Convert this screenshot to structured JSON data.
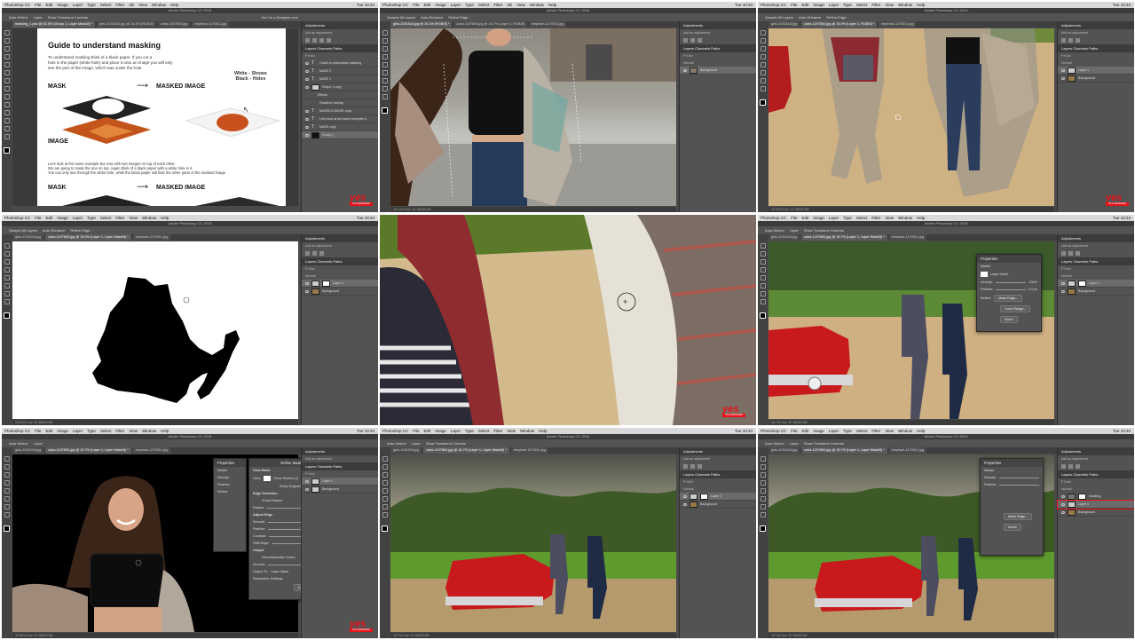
{
  "app": {
    "menu": [
      "Photoshop CC",
      "File",
      "Edit",
      "Image",
      "Layer",
      "Type",
      "Select",
      "Filter",
      "3D",
      "View",
      "Window",
      "Help"
    ],
    "window_title": "Adobe Photoshop CC 2016",
    "workspace_hint": "Yes I'm a Designer.com",
    "clock": "Tue 10:34"
  },
  "options": {
    "auto_select": "Auto-Select:",
    "layer": "Layer",
    "show_transform": "Show Transform Controls",
    "sample_all": "Sample All Layers",
    "auto_enhance": "Auto-Enhance",
    "refine_edge": "Refine Edge..."
  },
  "panels": {
    "adjustments": "Adjustments",
    "add_adjustment": "Add an adjustment",
    "layers_tabs": "Layers  Channels  Paths",
    "kind": "P Kind",
    "normal": "Normal",
    "opacity": "Opacity: 100%",
    "lock": "Lock:",
    "fill": "Fill: 100%",
    "properties": "Properties",
    "masks": "Masks",
    "layer_mask": "Layer Mask",
    "density": "Density:",
    "feather": "Feather:",
    "refine": "Refine:",
    "mask_edge": "Mask Edge...",
    "color_range": "Color Range...",
    "invert": "Invert",
    "density_value": "100%",
    "feather_value": "0.0 px"
  },
  "layers": {
    "background": "Background",
    "layer1": "Layer 1",
    "doc_layers": [
      "Guide to understand masking",
      "MASK 2",
      "MASK 1",
      "Shape 1 copy",
      "Effects",
      "Gradient Overlay",
      "MASKED IMAGE copy",
      "Let's look at the same example b...",
      "MASK copy",
      "Group 1"
    ],
    "masking_layer": "masking"
  },
  "tabs": [
    [
      "masking_1.psd @ 62.5% (Group 1, Layer Mask/8) *",
      "girls-1031518.jpg @ 16.1% (RGB/8)",
      "cuba-1197800.jpg",
      "elephant-1170511.jpg",
      "sea-918999.psd"
    ],
    [
      "girls-1031518.jpg @ 16.1% (RGB/8) *",
      "cuba-1197800.jpg @ 15.7% (Layer 1, RGB/8)",
      "elephant-1170511.jpg",
      "sea-918999.psd"
    ],
    [
      "girls-1031518.jpg",
      "cuba-1197800.jpg @ 15.0% (Layer 1, RGB/8) *",
      "elephant-1170511.jpg",
      "sea-918999.psd"
    ],
    [
      "girls-1031518.jpg",
      "cuba-1197800.jpg @ 15.0% (Layer 1, Layer Mask/8) *",
      "elephant-1170511.jpg",
      "sea-918999.psd"
    ],
    [
      "girls-1031518.jpg",
      "cuba-1197800.jpg @ 15.7% (Layer 1, Layer Mask/8) *",
      "elephant-1170511.jpg",
      "sea-918999.psd"
    ],
    [
      "girls-1031518.jpg",
      "cuba-1197800.jpg @ 15.7% (Layer 1, Layer Mask/8) *",
      "elephant-1170511.jpg",
      "sea-918999.psd"
    ],
    [
      "girls-1031518.jpg",
      "cuba-1197800.jpg @ 16.7% (Layer 1, Layer Mask/8) *",
      "elephant-1170511.jpg",
      "sea-918999.psd"
    ],
    [
      "girls-1031518.jpg",
      "cuba-1197800.jpg @ 15.7% (Layer 1, Layer Mask/8) *",
      "elephant-1170511.jpg",
      "sea-918999.psd"
    ]
  ],
  "status": [
    "62.5%   Doc: 3.29M/37.1M",
    "16.13%   Doc: 40.3M/28.4M",
    "15.02%   Doc: 57.9M/25.9M",
    "15.02%   Doc: 57.9M/25.9M",
    "15.7%   Doc: 57.9M/25.9M",
    "16.66%   Doc: 57.9M/25.9M",
    "15.7%   Doc: 57.9M/25.9M"
  ],
  "guide": {
    "title": "Guide to understand masking",
    "intro": [
      "To understand masking think of a black paper. If you cut a",
      "hole in the paper (white hole) and place it onto an image you will only",
      "see the part of the image, which was under the hole."
    ],
    "mask": "MASK",
    "masked_image": "MASKED IMAGE",
    "image": "IMAGE",
    "legend": [
      "White - Shows",
      "Black - Hides"
    ],
    "second": [
      "Let's look at the same example but now with two images on top of each other.",
      "We are going to mask the one on top. Again think of a black paper with a white hole in it.",
      "You can only see through the white hole, while the black paper will hide the other parts of the masked image"
    ],
    "mask2": "MASK",
    "masked_image2": "MASKED IMAGE"
  },
  "refine_mask": {
    "title": "Refine Mask",
    "view_mode": "View Mode",
    "view": "View:",
    "show_radius": "Show Radius (J)",
    "show_original": "Show Original (P)",
    "edge_detection": "Edge Detection",
    "smart_radius": "Smart Radius",
    "radius": "Radius:",
    "adjust_edge": "Adjust Edge",
    "smooth": "Smooth:",
    "feather": "Feather:",
    "contrast": "Contrast:",
    "shift_edge": "Shift Edge:",
    "output": "Output",
    "decontaminate": "Decontaminate Colors",
    "amount": "Amount:",
    "output_to": "Output To:",
    "output_to_value": "Layer Mask",
    "remember": "Remember Settings",
    "cancel": "Cancel",
    "ok": "OK",
    "radius_value": "0.0 px",
    "smooth_value": "0",
    "feather_value": "0.0 px",
    "contrast_value": "0%",
    "shift_value": "0%"
  },
  "logo": {
    "text": "yes",
    "tag": "I'M A DESIGNER"
  },
  "colors": {
    "ui_dark": "#4a4a4a",
    "panel": "#535353",
    "brand_red": "#e8131b",
    "car_red": "#c8191c"
  }
}
